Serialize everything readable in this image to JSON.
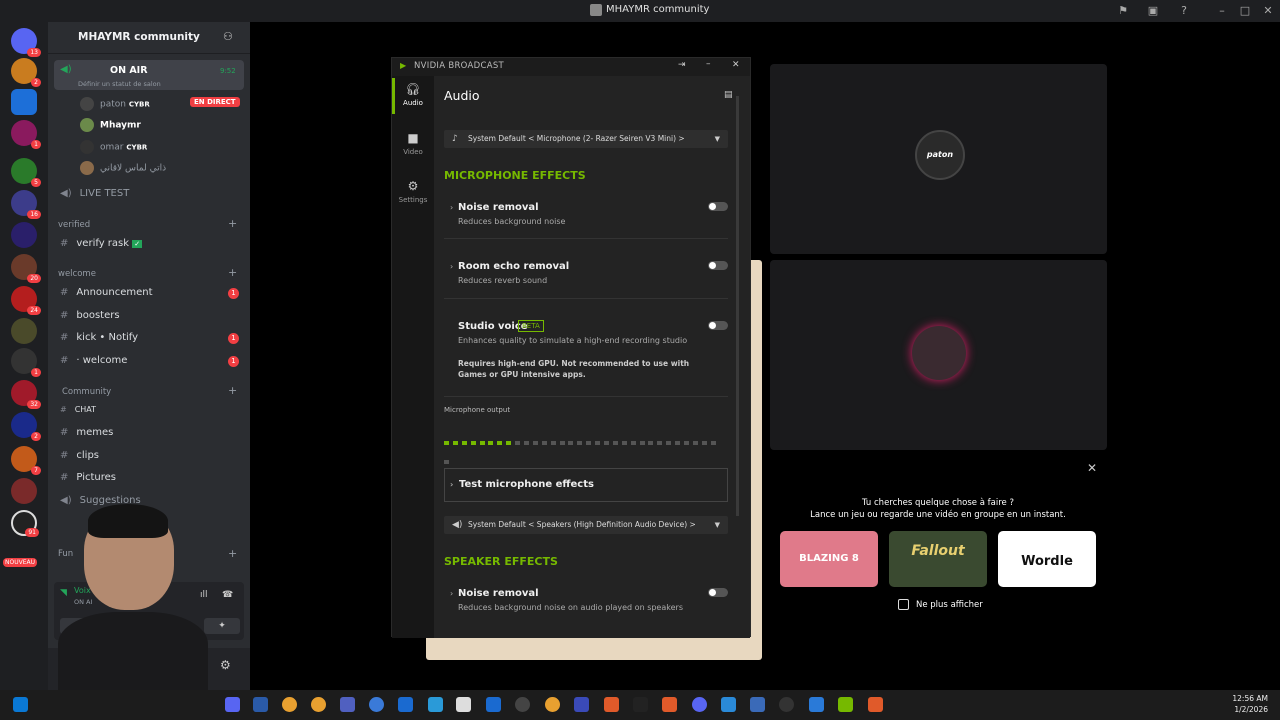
{
  "window": {
    "title": "MHAYMR community"
  },
  "discord": {
    "server_name": "MHAYMR community",
    "server_badges": [
      "13",
      "2",
      "",
      "1",
      "",
      "5",
      "16",
      "",
      "20",
      "24",
      "",
      "1",
      "2",
      "10",
      "6",
      "32",
      "2",
      "7",
      "",
      "91",
      "NOUVEAU"
    ],
    "voice_channel": {
      "name": "ON AIR",
      "time": "9:52",
      "status_placeholder": "Définir un statut de salon",
      "live_badge": "EN DIRECT",
      "users": [
        {
          "name": "paton",
          "tag": "CYBR"
        },
        {
          "name": "Mhaymr",
          "tag": ""
        },
        {
          "name": "omar",
          "tag": "CYBR"
        },
        {
          "name": "ذاتي لماس لاقاني",
          "tag": ""
        }
      ]
    },
    "live_test": "LIVE TEST",
    "categories": {
      "verified": "verified",
      "welcome": "welcome",
      "community": "Community",
      "fun": "Fun"
    },
    "channels": {
      "verify": "verify rask",
      "announcement": "Announcement",
      "boosters": "boosters",
      "kick": "kick • Notify",
      "welcome": "· welcome",
      "chat": "CHAT",
      "memes": "memes",
      "clips": "clips",
      "pictures": "Pictures",
      "suggestions": "Suggestions"
    },
    "unread": {
      "announcement": "1",
      "kick": "1",
      "welcome": "1"
    },
    "voice_connected": "Voix con",
    "voice_connected_sub": "ON AI",
    "user_short": "aym"
  },
  "nvidia": {
    "window_title": "NVIDIA BROADCAST",
    "nav": {
      "audio": "Audio",
      "video": "Video",
      "settings": "Settings"
    },
    "page_title": "Audio",
    "mic_device": "System Default < Microphone (2- Razer Seiren V3 Mini) >",
    "mic_section": "MICROPHONE EFFECTS",
    "effects": [
      {
        "title": "Noise removal",
        "sub": "Reduces background noise",
        "enabled": false
      },
      {
        "title": "Room echo removal",
        "sub": "Reduces reverb sound",
        "enabled": false
      },
      {
        "title": "Studio voice",
        "sub": "Enhances quality to simulate a high-end recording studio",
        "enabled": false
      }
    ],
    "beta": "BETA",
    "studio_warning_1": "Requires high-end GPU. Not recommended to use with",
    "studio_warning_2": "Games or GPU intensive apps.",
    "mic_output_label": "Microphone output",
    "mic_level_fraction": 0.24,
    "test_button": "Test microphone effects",
    "speaker_device": "System Default < Speakers (High Definition Audio Device) >",
    "speaker_section": "SPEAKER EFFECTS",
    "speaker_effect": {
      "title": "Noise removal",
      "sub": "Reduces background noise on audio played on speakers",
      "enabled": false
    }
  },
  "stream": {
    "tile_label": "paton",
    "activity_line1": "Tu cherches quelque chose à faire ?",
    "activity_line2": "Lance un jeu ou regarde une vidéo en groupe en un instant.",
    "games": [
      "BLAZING 8",
      "Fallout",
      "Wordle"
    ],
    "dont_show": "Ne plus afficher"
  },
  "taskbar": {
    "time": "12:56 AM",
    "date": "1/2/2026"
  },
  "colors": {
    "nvidia_green": "#76b900",
    "discord_red": "#f23f43",
    "discord_bg": "#2b2d31"
  }
}
